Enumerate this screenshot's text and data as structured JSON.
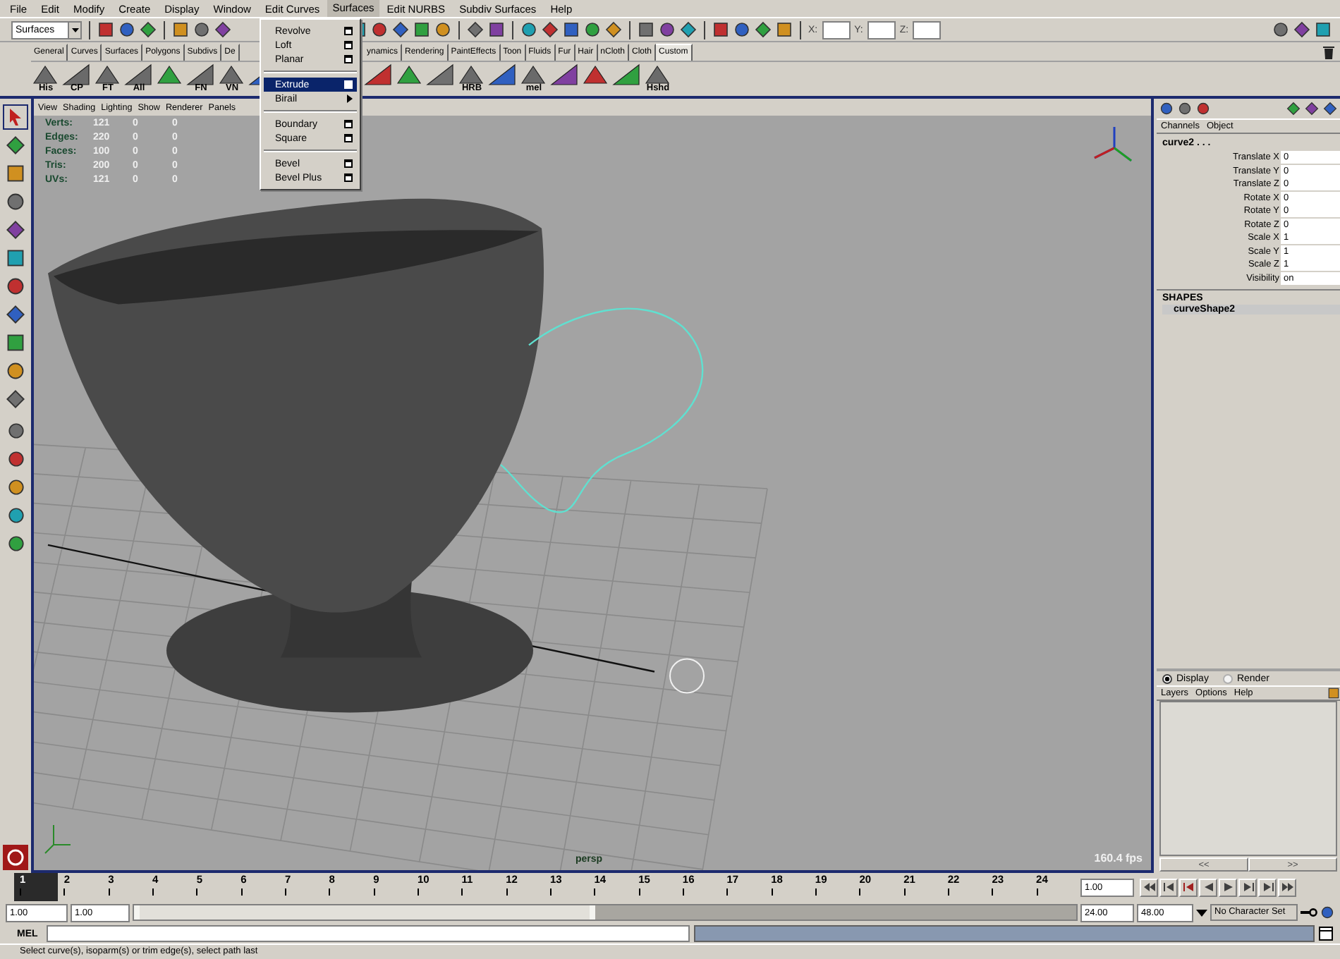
{
  "menu_bar": [
    {
      "label": "File",
      "selected": false
    },
    {
      "label": "Edit",
      "selected": false
    },
    {
      "label": "Modify",
      "selected": false
    },
    {
      "label": "Create",
      "selected": false
    },
    {
      "label": "Display",
      "selected": false
    },
    {
      "label": "Window",
      "selected": false
    },
    {
      "label": "Edit Curves",
      "selected": false
    },
    {
      "label": "Surfaces",
      "selected": true
    },
    {
      "label": "Edit NURBS",
      "selected": false
    },
    {
      "label": "Subdiv Surfaces",
      "selected": false
    },
    {
      "label": "Help",
      "selected": false
    }
  ],
  "status_line": {
    "menu_set": "Surfaces",
    "x_label": "X:",
    "y_label": "Y:",
    "z_label": "Z:"
  },
  "shelf_tabs": {
    "left": [
      {
        "label": "General",
        "selected": false
      },
      {
        "label": "Curves",
        "selected": false
      },
      {
        "label": "Surfaces",
        "selected": false
      },
      {
        "label": "Polygons",
        "selected": false
      },
      {
        "label": "Subdivs",
        "selected": false
      },
      {
        "label": "De",
        "selected": false
      }
    ],
    "right": [
      {
        "label": "ynamics",
        "selected": false
      },
      {
        "label": "Rendering",
        "selected": false
      },
      {
        "label": "PaintEffects",
        "selected": false
      },
      {
        "label": "Toon",
        "selected": false
      },
      {
        "label": "Fluids",
        "selected": false
      },
      {
        "label": "Fur",
        "selected": false
      },
      {
        "label": "Hair",
        "selected": false
      },
      {
        "label": "nCloth",
        "selected": false
      },
      {
        "label": "Cloth",
        "selected": false
      },
      {
        "label": "Custom",
        "selected": true
      }
    ]
  },
  "shelf_buttons": {
    "left": [
      {
        "kind": "labeled",
        "label": "His"
      },
      {
        "kind": "labeled",
        "label": "CP"
      },
      {
        "kind": "labeled",
        "label": "FT"
      },
      {
        "kind": "labeled",
        "label": "All"
      },
      {
        "kind": "icon"
      },
      {
        "kind": "labeled",
        "label": "FN"
      },
      {
        "kind": "labeled",
        "label": "VN"
      },
      {
        "kind": "icon"
      }
    ],
    "right": [
      {
        "kind": "icon"
      },
      {
        "kind": "icon"
      },
      {
        "kind": "icon"
      },
      {
        "kind": "labeled",
        "label": "HRB"
      },
      {
        "kind": "icon"
      },
      {
        "kind": "labeled",
        "label": "mel"
      },
      {
        "kind": "icon"
      },
      {
        "kind": "icon"
      },
      {
        "kind": "icon"
      },
      {
        "kind": "labeled",
        "label": "Hshd"
      }
    ]
  },
  "surfaces_menu": {
    "items": [
      {
        "kind": "item",
        "label": "Revolve",
        "options": true,
        "submenu": false,
        "selected": false
      },
      {
        "kind": "item",
        "label": "Loft",
        "options": true,
        "submenu": false,
        "selected": false
      },
      {
        "kind": "item",
        "label": "Planar",
        "options": true,
        "submenu": false,
        "selected": false
      },
      {
        "kind": "separator"
      },
      {
        "kind": "item",
        "label": "Extrude",
        "options": true,
        "submenu": false,
        "selected": true
      },
      {
        "kind": "item",
        "label": "Birail",
        "options": false,
        "submenu": true,
        "selected": false
      },
      {
        "kind": "separator"
      },
      {
        "kind": "item",
        "label": "Boundary",
        "options": true,
        "submenu": false,
        "selected": false
      },
      {
        "kind": "item",
        "label": "Square",
        "options": true,
        "submenu": false,
        "selected": false
      },
      {
        "kind": "separator"
      },
      {
        "kind": "item",
        "label": "Bevel",
        "options": true,
        "submenu": false,
        "selected": false
      },
      {
        "kind": "item",
        "label": "Bevel Plus",
        "options": true,
        "submenu": false,
        "selected": false
      }
    ]
  },
  "viewport": {
    "menu": [
      "View",
      "Shading",
      "Lighting",
      "Show",
      "Renderer",
      "Panels"
    ],
    "hud": [
      {
        "label": "Verts:",
        "values": [
          "121",
          "0",
          "0"
        ]
      },
      {
        "label": "Edges:",
        "values": [
          "220",
          "0",
          "0"
        ]
      },
      {
        "label": "Faces:",
        "values": [
          "100",
          "0",
          "0"
        ]
      },
      {
        "label": "Tris:",
        "values": [
          "200",
          "0",
          "0"
        ]
      },
      {
        "label": "UVs:",
        "values": [
          "121",
          "0",
          "0"
        ]
      }
    ],
    "camera": "persp",
    "fps": "160.4 fps"
  },
  "channel_box": {
    "menu": [
      "Channels",
      "Object"
    ],
    "node": "curve2 . . .",
    "attributes": [
      {
        "name": "Translate X",
        "value": "0"
      },
      {
        "name": "Translate Y",
        "value": "0"
      },
      {
        "name": "Translate Z",
        "value": "0"
      },
      {
        "name": "Rotate X",
        "value": "0"
      },
      {
        "name": "Rotate Y",
        "value": "0"
      },
      {
        "name": "Rotate Z",
        "value": "0"
      },
      {
        "name": "Scale X",
        "value": "1"
      },
      {
        "name": "Scale Y",
        "value": "1"
      },
      {
        "name": "Scale Z",
        "value": "1"
      },
      {
        "name": "Visibility",
        "value": "on"
      }
    ],
    "shapes_heading": "SHAPES",
    "shape": "curveShape2"
  },
  "layer_editor": {
    "modes": [
      {
        "label": "Display",
        "selected": true
      },
      {
        "label": "Render",
        "selected": false
      }
    ],
    "menu": [
      "Layers",
      "Options",
      "Help"
    ],
    "scroll_buttons": [
      "<<",
      ">>"
    ]
  },
  "timeline": {
    "frames": [
      {
        "label": "1",
        "selected": true
      },
      {
        "label": "2",
        "selected": false
      },
      {
        "label": "3",
        "selected": false
      },
      {
        "label": "4",
        "selected": false
      },
      {
        "label": "5",
        "selected": false
      },
      {
        "label": "6",
        "selected": false
      },
      {
        "label": "7",
        "selected": false
      },
      {
        "label": "8",
        "selected": false
      },
      {
        "label": "9",
        "selected": false
      },
      {
        "label": "10",
        "selected": false
      },
      {
        "label": "11",
        "selected": false
      },
      {
        "label": "12",
        "selected": false
      },
      {
        "label": "13",
        "selected": false
      },
      {
        "label": "14",
        "selected": false
      },
      {
        "label": "15",
        "selected": false
      },
      {
        "label": "16",
        "selected": false
      },
      {
        "label": "17",
        "selected": false
      },
      {
        "label": "18",
        "selected": false
      },
      {
        "label": "19",
        "selected": false
      },
      {
        "label": "20",
        "selected": false
      },
      {
        "label": "21",
        "selected": false
      },
      {
        "label": "22",
        "selected": false
      },
      {
        "label": "23",
        "selected": false
      },
      {
        "label": "24",
        "selected": false
      }
    ],
    "current_frame": "1.00"
  },
  "range": {
    "level": 0.49,
    "start": "1.00",
    "range_start": "1.00",
    "range_end": "24.00",
    "end": "48.00",
    "character_set": "No Character Set"
  },
  "command_line": {
    "label": "MEL"
  },
  "help_line": "Select curve(s), isoparm(s) or trim edge(s), select path last"
}
